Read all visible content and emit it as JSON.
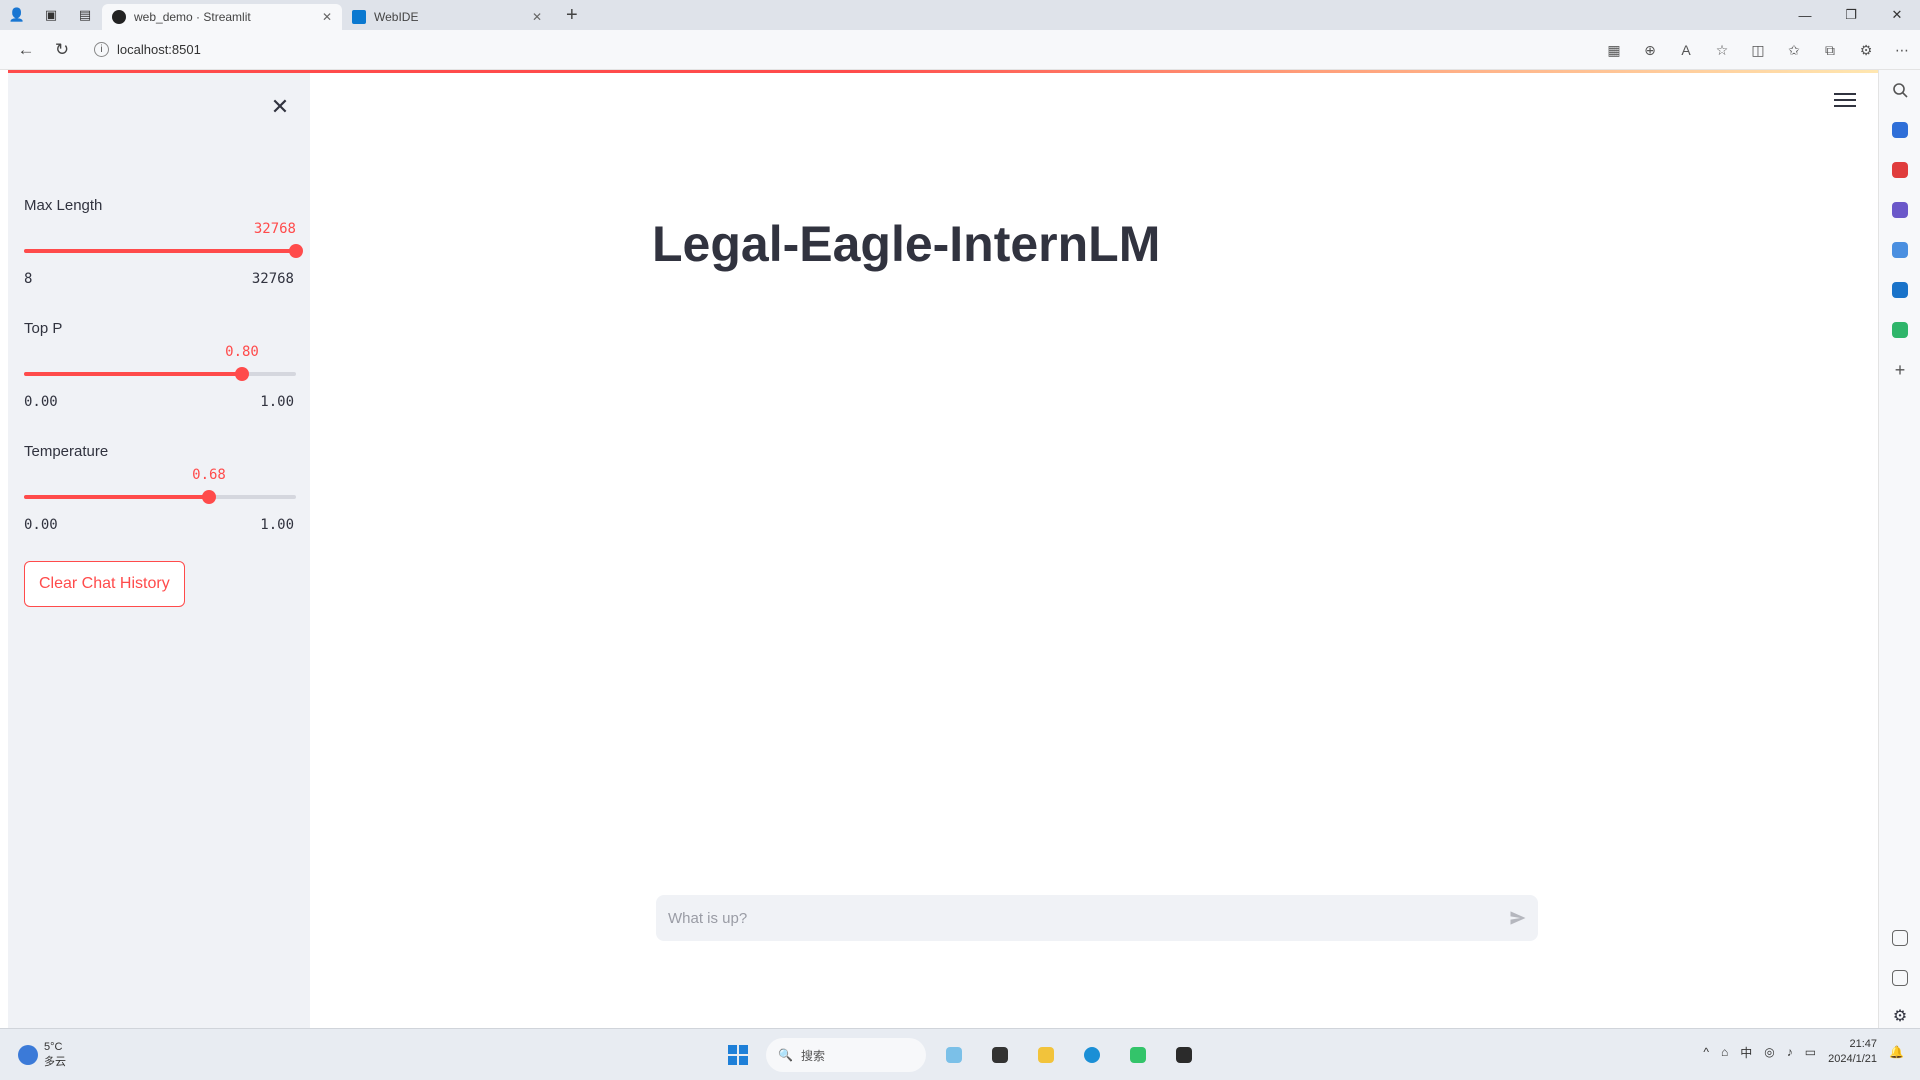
{
  "browser": {
    "tabs": [
      {
        "label": "web_demo · Streamlit",
        "active": true
      },
      {
        "label": "WebIDE",
        "active": false
      }
    ],
    "url": "localhost:8501"
  },
  "sidebar": {
    "sliders": [
      {
        "label": "Max Length",
        "value_text": "32768",
        "min_text": "8",
        "max_text": "32768",
        "fraction": 1.0
      },
      {
        "label": "Top P",
        "value_text": "0.80",
        "min_text": "0.00",
        "max_text": "1.00",
        "fraction": 0.8
      },
      {
        "label": "Temperature",
        "value_text": "0.68",
        "min_text": "0.00",
        "max_text": "1.00",
        "fraction": 0.68
      }
    ],
    "clear_button": "Clear Chat History"
  },
  "main": {
    "title": "Legal-Eagle-InternLM",
    "chat_placeholder": "What is up?"
  },
  "taskbar": {
    "weather_temp": "5°C",
    "weather_desc": "多云",
    "search_label": "搜索",
    "tray_lang": "中",
    "time": "21:47",
    "date": "2024/1/21"
  },
  "colors": {
    "accent": "#ff4b4b",
    "sidebar_bg": "#f0f2f6",
    "text": "#31333f"
  }
}
